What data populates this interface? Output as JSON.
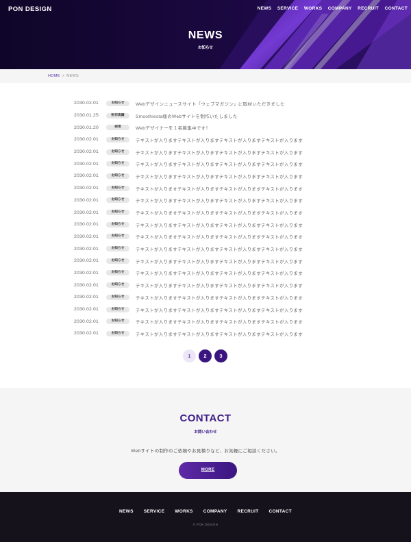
{
  "header": {
    "logo": "PON DESIGN",
    "nav": [
      "NEWS",
      "SERVICE",
      "WORKS",
      "COMPANY",
      "RECRUIT",
      "CONTACT"
    ],
    "title": "NEWS",
    "subtitle": "お知らせ"
  },
  "breadcrumb": {
    "home": "HOME",
    "separator": ">",
    "current": "NEWS"
  },
  "news": [
    {
      "date": "2030.02.01",
      "category": "お知らせ",
      "title": "Webデザインニュースサイト「ウェブマガジン」に取材いただきました"
    },
    {
      "date": "2030.01.25",
      "category": "制作実績",
      "title": "Smoothiesta様のWebサイトを制作いたしました"
    },
    {
      "date": "2030.01.20",
      "category": "採用",
      "title": "Webデザイナーを１名募集中です！"
    },
    {
      "date": "2030.02.01",
      "category": "お知らせ",
      "title": "テキストが入りますテキストが入りますテキストが入りますテキストが入ります"
    },
    {
      "date": "2030.02.01",
      "category": "お知らせ",
      "title": "テキストが入りますテキストが入りますテキストが入りますテキストが入ります"
    },
    {
      "date": "2030.02.01",
      "category": "お知らせ",
      "title": "テキストが入りますテキストが入りますテキストが入りますテキストが入ります"
    },
    {
      "date": "2030.02.01",
      "category": "お知らせ",
      "title": "テキストが入りますテキストが入りますテキストが入りますテキストが入ります"
    },
    {
      "date": "2030.02.01",
      "category": "お知らせ",
      "title": "テキストが入りますテキストが入りますテキストが入りますテキストが入ります"
    },
    {
      "date": "2030.02.01",
      "category": "お知らせ",
      "title": "テキストが入りますテキストが入りますテキストが入りますテキストが入ります"
    },
    {
      "date": "2030.02.01",
      "category": "お知らせ",
      "title": "テキストが入りますテキストが入りますテキストが入りますテキストが入ります"
    },
    {
      "date": "2030.02.01",
      "category": "お知らせ",
      "title": "テキストが入りますテキストが入りますテキストが入りますテキストが入ります"
    },
    {
      "date": "2030.02.01",
      "category": "お知らせ",
      "title": "テキストが入りますテキストが入りますテキストが入りますテキストが入ります"
    },
    {
      "date": "2030.02.01",
      "category": "お知らせ",
      "title": "テキストが入りますテキストが入りますテキストが入りますテキストが入ります"
    },
    {
      "date": "2030.02.01",
      "category": "お知らせ",
      "title": "テキストが入りますテキストが入りますテキストが入りますテキストが入ります"
    },
    {
      "date": "2030.02.01",
      "category": "お知らせ",
      "title": "テキストが入りますテキストが入りますテキストが入りますテキストが入ります"
    },
    {
      "date": "2030.02.01",
      "category": "お知らせ",
      "title": "テキストが入りますテキストが入りますテキストが入りますテキストが入ります"
    },
    {
      "date": "2030.02.01",
      "category": "お知らせ",
      "title": "テキストが入りますテキストが入りますテキストが入りますテキストが入ります"
    },
    {
      "date": "2030.02.01",
      "category": "お知らせ",
      "title": "テキストが入りますテキストが入りますテキストが入りますテキストが入ります"
    },
    {
      "date": "2030.02.01",
      "category": "お知らせ",
      "title": "テキストが入りますテキストが入りますテキストが入りますテキストが入ります"
    },
    {
      "date": "2030.02.01",
      "category": "お知らせ",
      "title": "テキストが入りますテキストが入りますテキストが入りますテキストが入ります"
    }
  ],
  "pagination": {
    "pages": [
      "1",
      "2",
      "3"
    ],
    "current": "1"
  },
  "contact": {
    "title": "CONTACT",
    "subtitle": "お問い合わせ",
    "text": "Webサイトの制作のご依頼やお見積りなど、お気軽にご相談ください。",
    "button": "MORE"
  },
  "footer": {
    "nav": [
      "NEWS",
      "SERVICE",
      "WORKS",
      "COMPANY",
      "RECRUIT",
      "CONTACT"
    ],
    "copyright": "© PON DESIGN"
  },
  "colors": {
    "hero_bg": "#12062e",
    "accent": "#5a2fa8",
    "brand_dark": "#3c1b86",
    "footer_bg": "#15121c"
  }
}
